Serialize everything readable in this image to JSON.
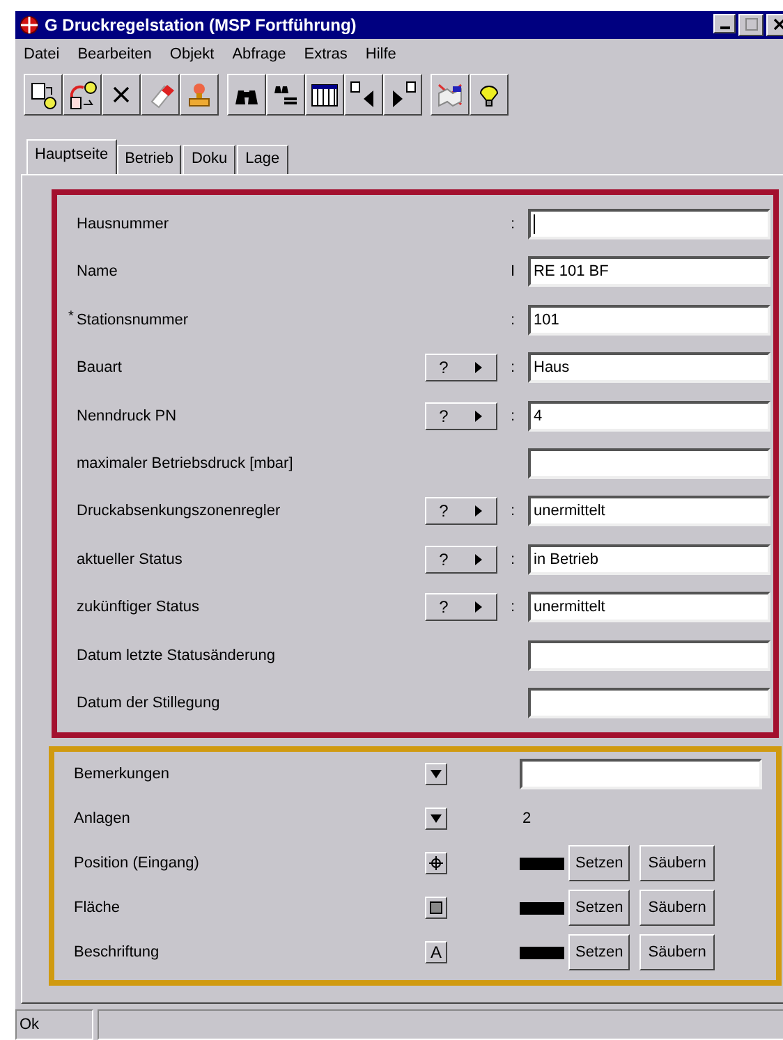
{
  "window": {
    "title": "G Druckregelstation (MSP Fortführung)"
  },
  "menu": [
    "Datei",
    "Bearbeiten",
    "Objekt",
    "Abfrage",
    "Extras",
    "Hilfe"
  ],
  "tabs": [
    {
      "label": "Hauptseite",
      "selected": true
    },
    {
      "label": "Betrieb",
      "selected": false
    },
    {
      "label": "Doku",
      "selected": false
    },
    {
      "label": "Lage",
      "selected": false
    }
  ],
  "fields": [
    {
      "label": "Hausnummer",
      "separator": ":",
      "focused": true
    },
    {
      "label": "Name",
      "separator": "I",
      "value": "RE 101 BF"
    },
    {
      "label": "Stationsnummer",
      "required": "*",
      "separator": ":",
      "value": "101"
    },
    {
      "label": "Bauart",
      "picker": "?",
      "separator": ":",
      "value": "Haus"
    },
    {
      "label": "Nenndruck PN",
      "picker": "?",
      "separator": ":",
      "value": "4"
    },
    {
      "label": "maximaler Betriebsdruck [mbar]"
    },
    {
      "label": "Druckabsenkungszonenregler",
      "picker": "?",
      "separator": ":",
      "value": "unermittelt"
    },
    {
      "label": "aktueller Status",
      "picker": "?",
      "separator": ":",
      "value": "in Betrieb"
    },
    {
      "label": "zukünftiger Status",
      "picker": "?",
      "separator": ":",
      "value": "unermittelt"
    },
    {
      "label": "Datum letzte Statusänderung"
    },
    {
      "label": "Datum der Stillegung"
    }
  ],
  "extras": [
    {
      "kind": "memo",
      "label": "Bemerkungen"
    },
    {
      "kind": "count",
      "label": "Anlagen",
      "count": "2"
    },
    {
      "kind": "point",
      "label": "Position (Eingang)",
      "set": "Setzen",
      "clear": "Säubern"
    },
    {
      "kind": "area",
      "label": "Fläche",
      "set": "Setzen",
      "clear": "Säubern"
    },
    {
      "kind": "text",
      "label": "Beschriftung",
      "button_label": "A",
      "set": "Setzen",
      "clear": "Säubern"
    }
  ],
  "status_bar": [
    "Ok"
  ]
}
